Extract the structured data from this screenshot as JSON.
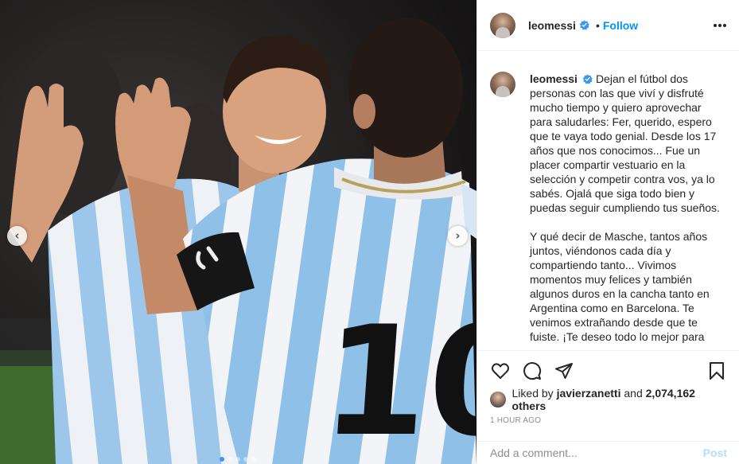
{
  "user": {
    "username": "leomessi",
    "follow_label": "Follow",
    "separator": "•"
  },
  "caption": {
    "paragraphs": [
      "Dejan el fútbol dos personas con las que viví y disfruté mucho tiempo y quiero aprovechar para saludarles: Fer, querido, espero que te vaya todo genial. Desde los 17 años que nos conocimos... Fue un placer compartir vestuario en la selección y competir contra vos, ya lo sabés. Ojalá que siga todo bien y puedas seguir cumpliendo tus sueños.",
      "Y qué decir de Masche, tantos años juntos, viéndonos cada día y compartiendo tanto... Vivimos momentos muy felices y también algunos duros en la cancha tanto en Argentina como en Barcelona. Te venimos extrañando desde que te fuiste. ¡Te deseo todo lo mejor para"
    ]
  },
  "photo": {
    "jersey_number": "10",
    "carousel_prev": "‹",
    "carousel_next": "›",
    "slides_total": 5,
    "slide_active": 1
  },
  "likes": {
    "prefix": "Liked by",
    "user": "javierzanetti",
    "conjunction": "and",
    "count": "2,074,162 others"
  },
  "timestamp": "1 HOUR AGO",
  "comment": {
    "placeholder": "Add a comment...",
    "post_label": "Post"
  },
  "icons": {
    "verified": "verified-badge-icon",
    "like": "heart-icon",
    "comment": "comment-bubble-icon",
    "share": "paper-plane-icon",
    "save": "bookmark-icon",
    "more": "more-dots-icon"
  },
  "colors": {
    "accent": "#0095f6",
    "post_disabled": "#b2dffc",
    "jersey_blue": "#8fc0e8",
    "jersey_white": "#f4f6f8",
    "text": "#262626",
    "muted": "#8e8e8e"
  }
}
